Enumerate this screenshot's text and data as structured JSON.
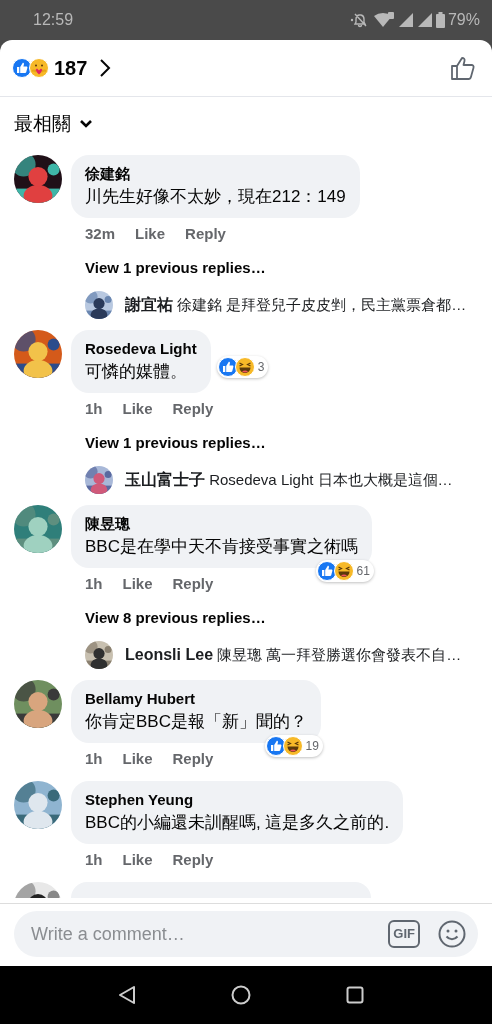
{
  "status_bar": {
    "time": "12:59",
    "battery": "79%"
  },
  "header": {
    "reactions": [
      {
        "kind": "like"
      },
      {
        "kind": "care"
      }
    ],
    "count": "187"
  },
  "sort": {
    "label": "最相關"
  },
  "comments": [
    {
      "kind": "comment",
      "author": "徐建銘",
      "text": "川先生好像不太妙，現在212：149",
      "time": "32m",
      "like": "Like",
      "reply": "Reply",
      "view_replies": "View 1 previous replies…",
      "latest_reply": "**謝宜祐** 徐建銘 是拜登兒子皮皮剉，民主黨票倉都…"
    },
    {
      "kind": "comment",
      "author": "Rosedeva Light",
      "text": "可憐的媒體。",
      "reactions": {
        "types": [
          {
            "kind": "like"
          },
          {
            "kind": "haha"
          }
        ],
        "count": "3",
        "overlaps_bubble": false
      },
      "time": "1h",
      "like": "Like",
      "reply": "Reply",
      "view_replies": "View 1 previous replies…",
      "latest_reply": "**玉山富士子** Rosedeva Light  日本也大概是這個…"
    },
    {
      "kind": "comment",
      "author": "陳昱璁",
      "text": "BBC是在學中天不肯接受事實之術嗎",
      "reactions": {
        "types": [
          {
            "kind": "like"
          },
          {
            "kind": "haha"
          }
        ],
        "count": "61",
        "overlaps_bubble": true
      },
      "time": "1h",
      "like": "Like",
      "reply": "Reply",
      "view_replies": "View 8 previous replies…",
      "latest_reply": "**Leonsli Lee** 陳昱璁 萬一拜登勝選你會發表不自…"
    },
    {
      "kind": "comment",
      "author": "Bellamy Hubert",
      "text": "你肯定BBC是報「新」聞的？",
      "reactions": {
        "types": [
          {
            "kind": "like"
          },
          {
            "kind": "haha"
          }
        ],
        "count": "19",
        "overlaps_bubble": true
      },
      "time": "1h",
      "like": "Like",
      "reply": "Reply"
    },
    {
      "kind": "comment",
      "author": "Stephen Yeung",
      "text": "BBC的小編還未訓醒嗎, 這是多久之前的.",
      "time": "1h",
      "like": "Like",
      "reply": "Reply"
    },
    {
      "kind": "cut_off"
    }
  ],
  "composer": {
    "placeholder": "Write a comment…",
    "gif": "GIF"
  }
}
